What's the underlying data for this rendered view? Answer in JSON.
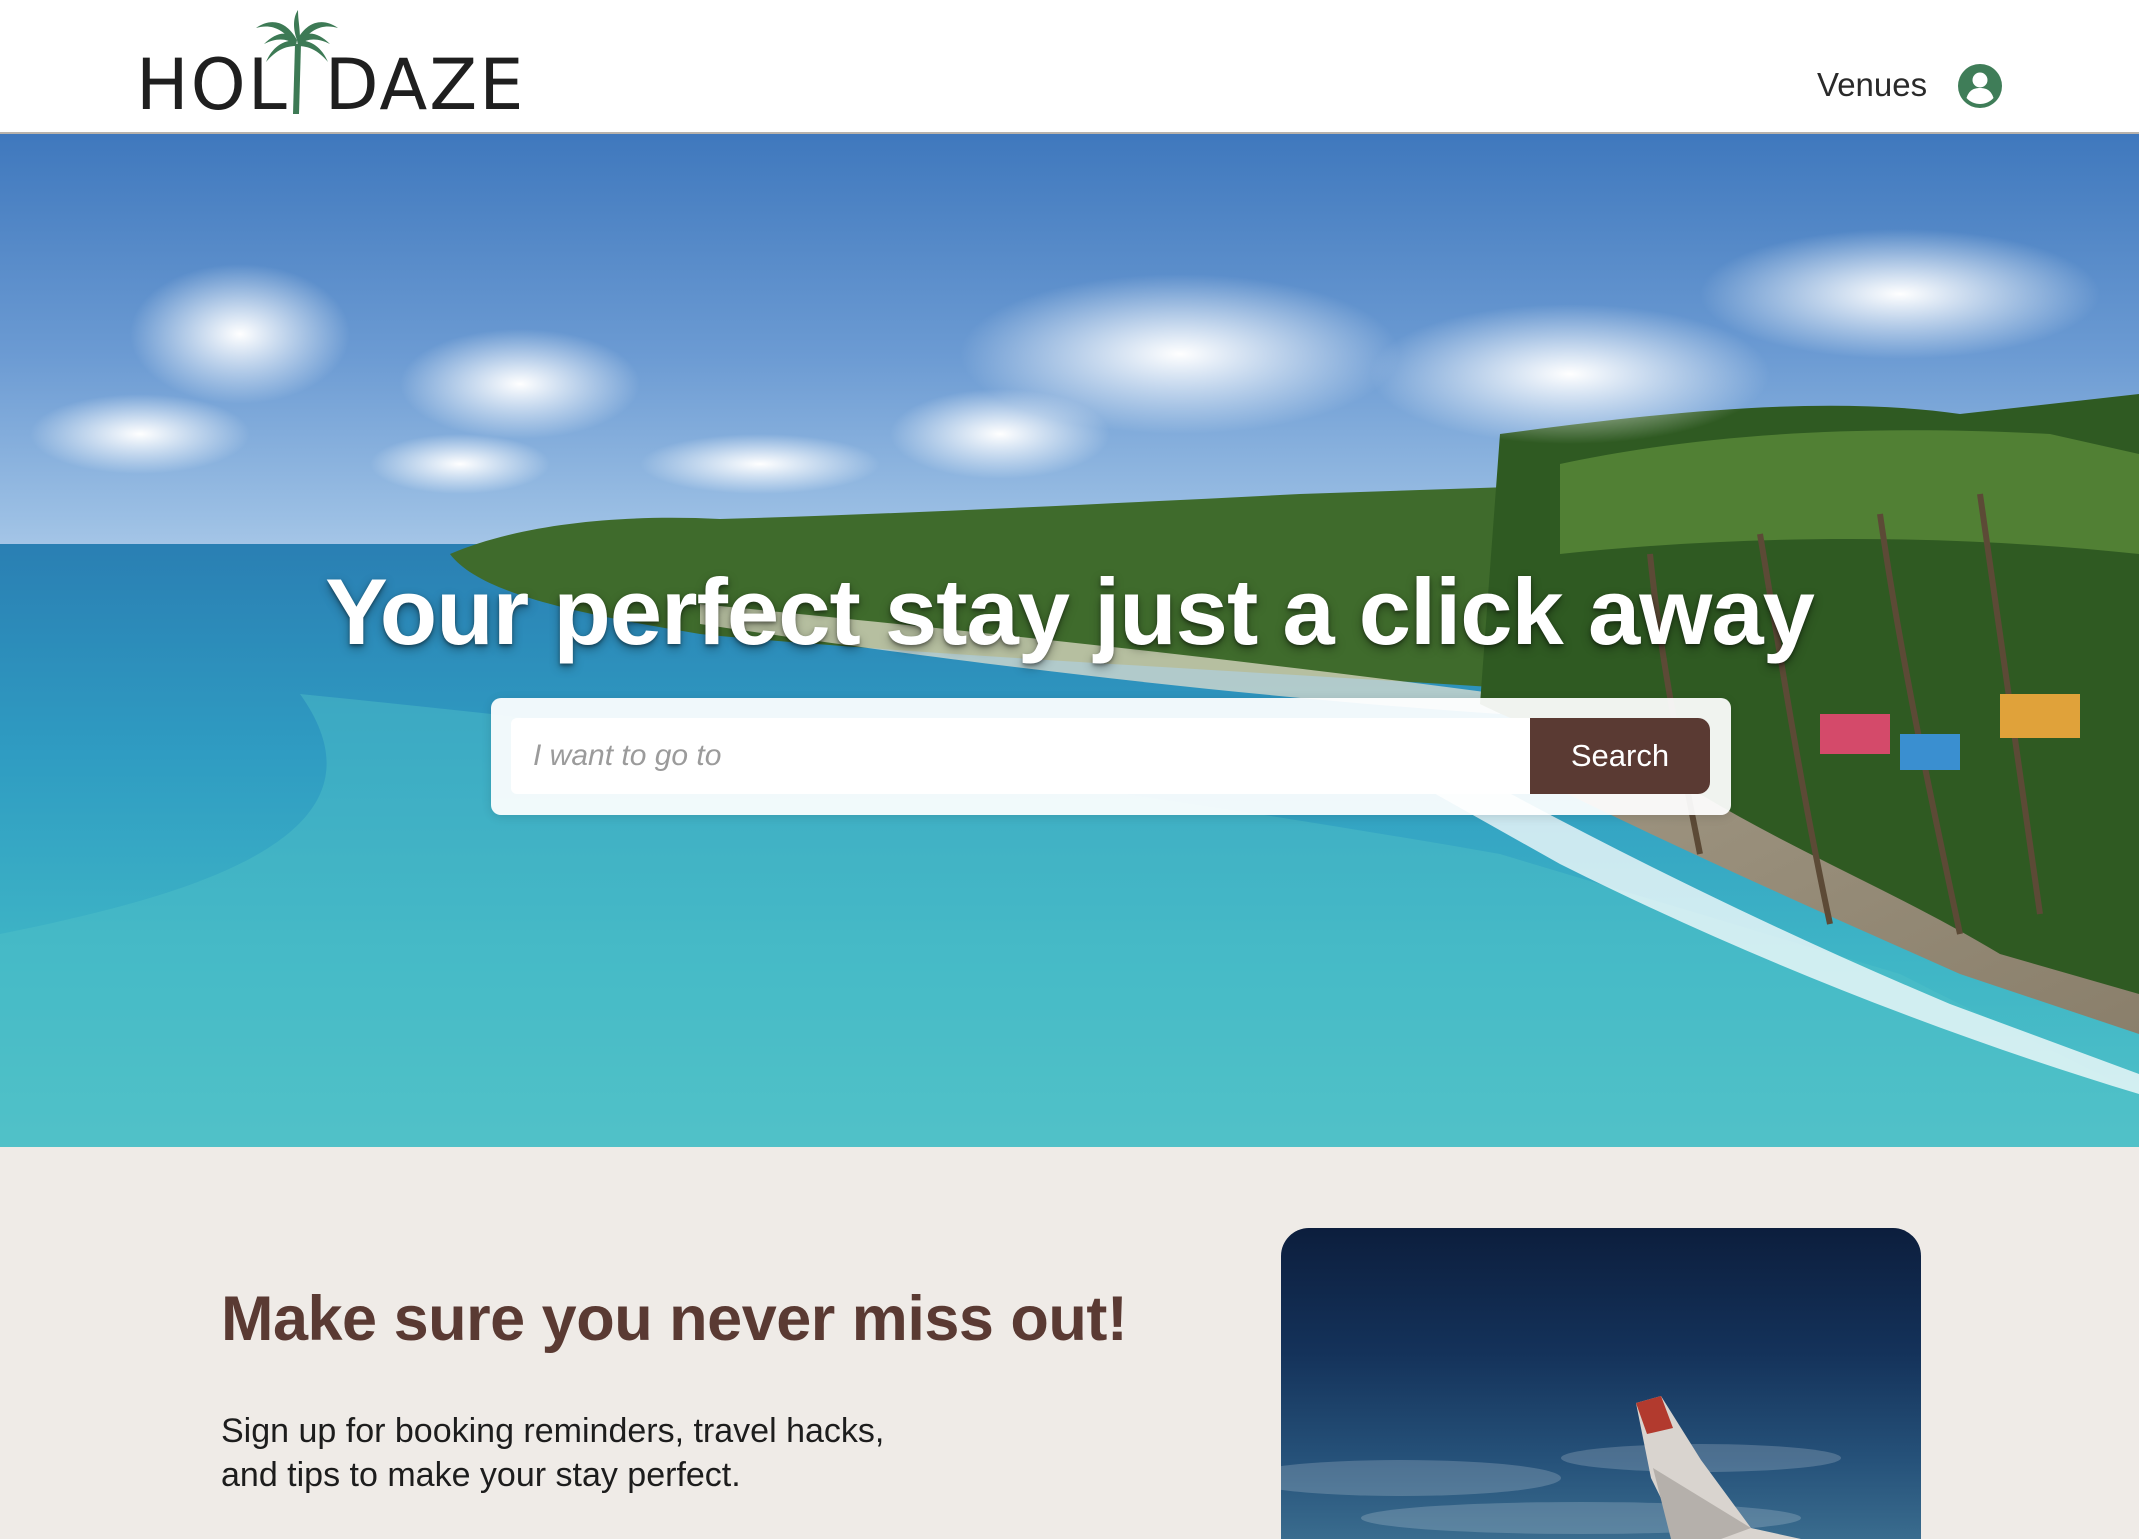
{
  "brand": {
    "logo_text_left": "HOL",
    "logo_text_right": "DAZE",
    "logo_icon": "palm-tree-icon",
    "logo_icon_color": "#3d7a55"
  },
  "nav": {
    "venues_label": "Venues",
    "profile_icon": "user-circle-icon",
    "profile_icon_color": "#3f7d58"
  },
  "hero": {
    "title": "Your perfect stay just a click away",
    "search_placeholder": "I want to go to",
    "search_value": "",
    "search_button_label": "Search",
    "button_color": "#5a3a33"
  },
  "promo": {
    "heading": "Make sure you never miss out!",
    "text_line_1": "Sign up for booking reminders, travel hacks,",
    "text_line_2": "and tips to make your stay perfect.",
    "heading_color": "#5a3a33",
    "background_color": "#efebe7"
  }
}
